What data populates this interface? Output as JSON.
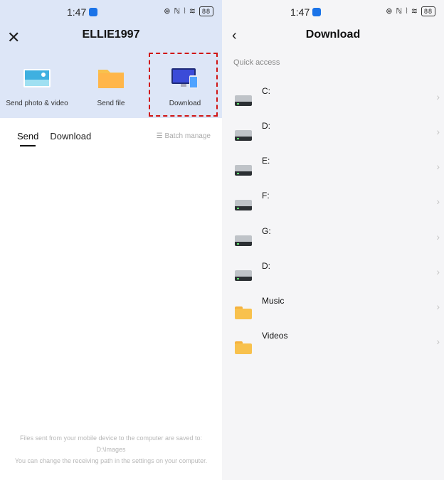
{
  "left": {
    "status": {
      "time": "1:47",
      "icons": "⊛ ℕ ⦚ ≋",
      "battery": "88"
    },
    "title": "ELLIE1997",
    "actions": [
      {
        "label": "Send photo & video",
        "icon": "image-icon"
      },
      {
        "label": "Send file",
        "icon": "folder-icon"
      },
      {
        "label": "Download",
        "icon": "monitor-phone-icon"
      }
    ],
    "tabs": [
      {
        "label": "Send"
      },
      {
        "label": "Download"
      }
    ],
    "batch_manage": "☰ Batch manage",
    "note_line1": "Files sent from your mobile device to the computer are saved to:",
    "note_line2": "D:\\Images",
    "note_line3": "You can change the receiving path in the settings on your computer."
  },
  "right": {
    "status": {
      "time": "1:47",
      "icons": "⊛ ℕ ⦚ ≋",
      "battery": "88"
    },
    "title": "Download",
    "section_label": "Quick access",
    "items": [
      {
        "name": "C:",
        "type": "drive"
      },
      {
        "name": "D:",
        "type": "drive"
      },
      {
        "name": "E:",
        "type": "drive"
      },
      {
        "name": "F:",
        "type": "drive"
      },
      {
        "name": "G:",
        "type": "drive"
      },
      {
        "name": "D:",
        "type": "drive"
      },
      {
        "name": "Music",
        "type": "folder"
      },
      {
        "name": "Videos",
        "type": "folder"
      }
    ]
  },
  "colors": {
    "header_bg": "#dde6f7",
    "highlight": "#d01515",
    "accent": "#1a73e8",
    "folder": "#f8c14d"
  }
}
